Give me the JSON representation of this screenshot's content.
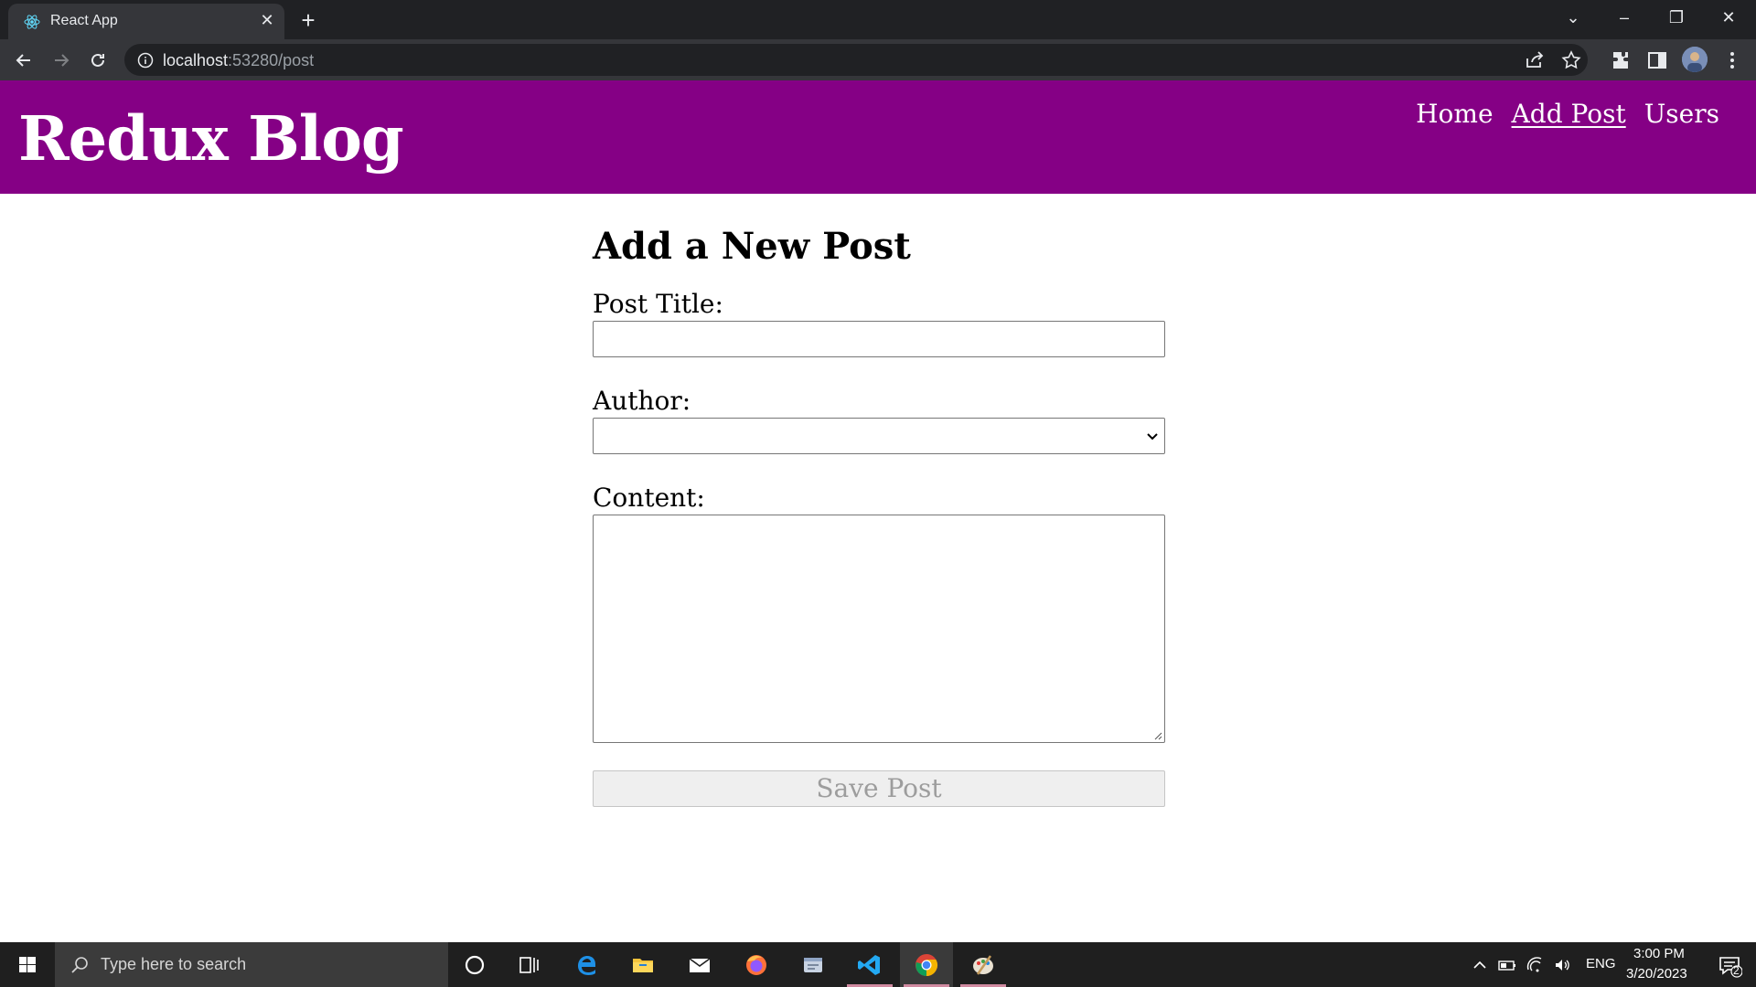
{
  "browser": {
    "tab_title": "React App",
    "new_tab_symbol": "+",
    "url_host": "localhost",
    "url_rest": ":53280/post"
  },
  "site": {
    "title": "Redux Blog",
    "nav": [
      {
        "label": "Home",
        "active": false
      },
      {
        "label": "Add Post",
        "active": true
      },
      {
        "label": "Users",
        "active": false
      }
    ]
  },
  "form": {
    "heading": "Add a New Post",
    "title_label": "Post Title:",
    "title_value": "",
    "author_label": "Author:",
    "author_selected": "",
    "content_label": "Content:",
    "content_value": "",
    "save_label": "Save Post",
    "save_disabled": true
  },
  "taskbar": {
    "search_placeholder": "Type here to search",
    "language": "ENG",
    "time": "3:00 PM",
    "date": "3/20/2023",
    "notification_count": "2"
  },
  "colors": {
    "header_bg": "#850085",
    "chrome_dark": "#202124",
    "chrome_toolbar": "#35363a"
  }
}
